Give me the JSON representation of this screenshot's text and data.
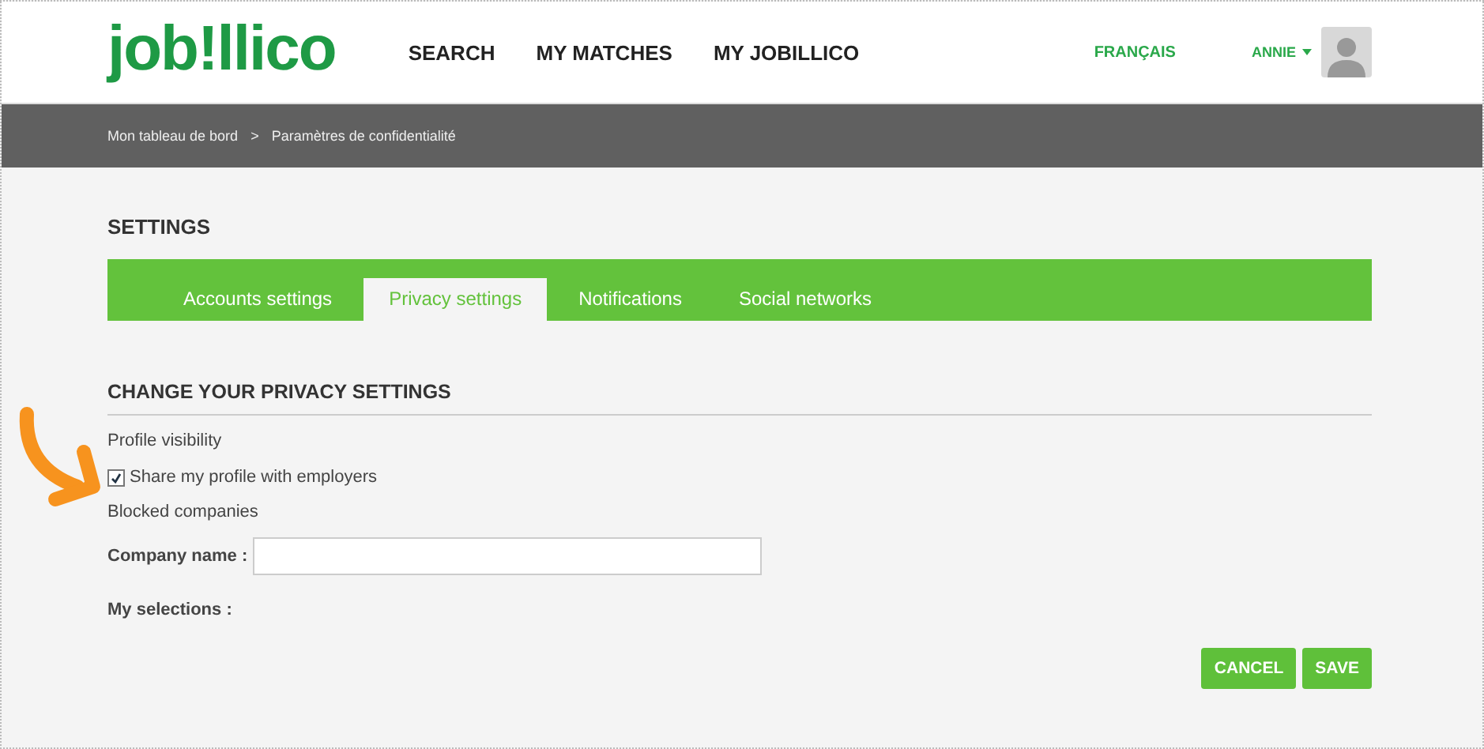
{
  "header": {
    "logo": "job!llico",
    "nav": [
      "SEARCH",
      "MY MATCHES",
      "MY JOBILLICO"
    ],
    "language": "FRANÇAIS",
    "user": "ANNIE"
  },
  "breadcrumb": {
    "items": [
      "Mon tableau de bord",
      "Paramètres de confidentialité"
    ],
    "separator": ">"
  },
  "settings": {
    "title": "SETTINGS",
    "tabs": [
      {
        "label": "Accounts settings",
        "selected": false
      },
      {
        "label": "Privacy settings",
        "selected": true
      },
      {
        "label": "Notifications",
        "selected": false
      },
      {
        "label": "Social networks",
        "selected": false
      }
    ]
  },
  "privacy": {
    "heading": "CHANGE YOUR PRIVACY SETTINGS",
    "visibility_label": "Profile visibility",
    "share_checkbox": {
      "label": "Share my profile with employers",
      "checked": true
    },
    "blocked_label": "Blocked companies",
    "company_field": {
      "label": "Company name :"
    },
    "selections_label": "My selections :"
  },
  "buttons": [
    "CANCEL",
    "SAVE"
  ]
}
